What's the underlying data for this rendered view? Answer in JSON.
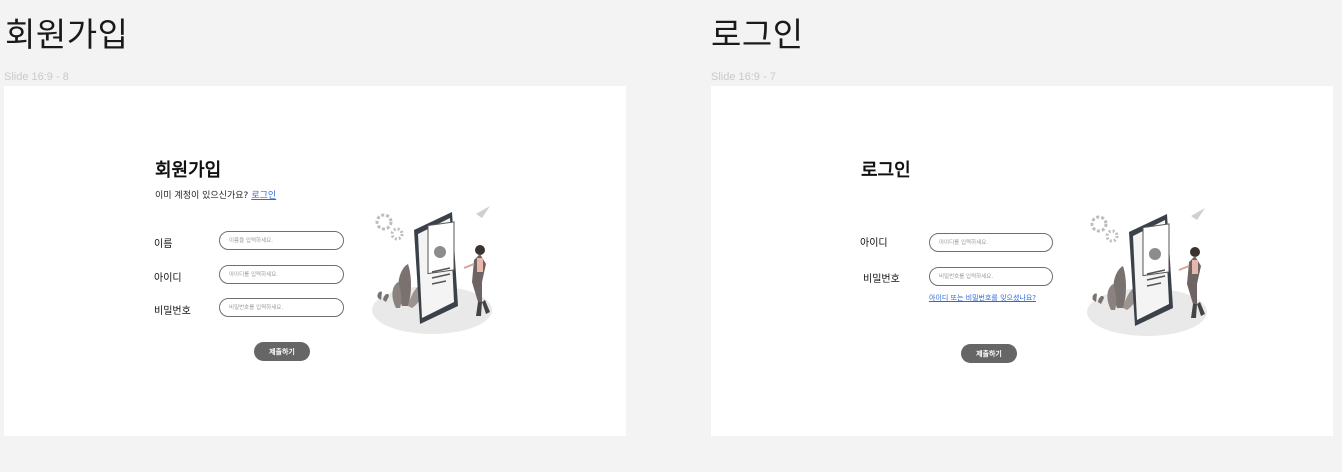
{
  "signup": {
    "heading": "회원가입",
    "frame_label": "Slide 16:9 - 8",
    "title": "회원가입",
    "sub_text": "이미 계정이 있으신가요?",
    "login_link": "로그인",
    "fields": [
      {
        "label": "이름",
        "placeholder": "이름을 입력하세요."
      },
      {
        "label": "아이디",
        "placeholder": "아이디를 입력하세요."
      },
      {
        "label": "비밀번호",
        "placeholder": "비밀번호를 입력하세요."
      }
    ],
    "submit_label": "제출하기"
  },
  "login": {
    "heading": "로그인",
    "frame_label": "Slide 16:9 - 7",
    "title": "로그인",
    "fields": [
      {
        "label": "아이디",
        "placeholder": "아이디를 입력하세요."
      },
      {
        "label": "비밀번호",
        "placeholder": "비밀번호를 입력하세요."
      }
    ],
    "forgot_link": "아이디 또는 비밀번호를 잊으셨나요?",
    "submit_label": "제출하기"
  },
  "colors": {
    "canvas": "#f3f3f3",
    "slide": "#ffffff",
    "button": "#666666",
    "link": "#2f6ad9",
    "phone": "#3b4148"
  },
  "illustration": {
    "icon": "phone-profile-illustration"
  }
}
